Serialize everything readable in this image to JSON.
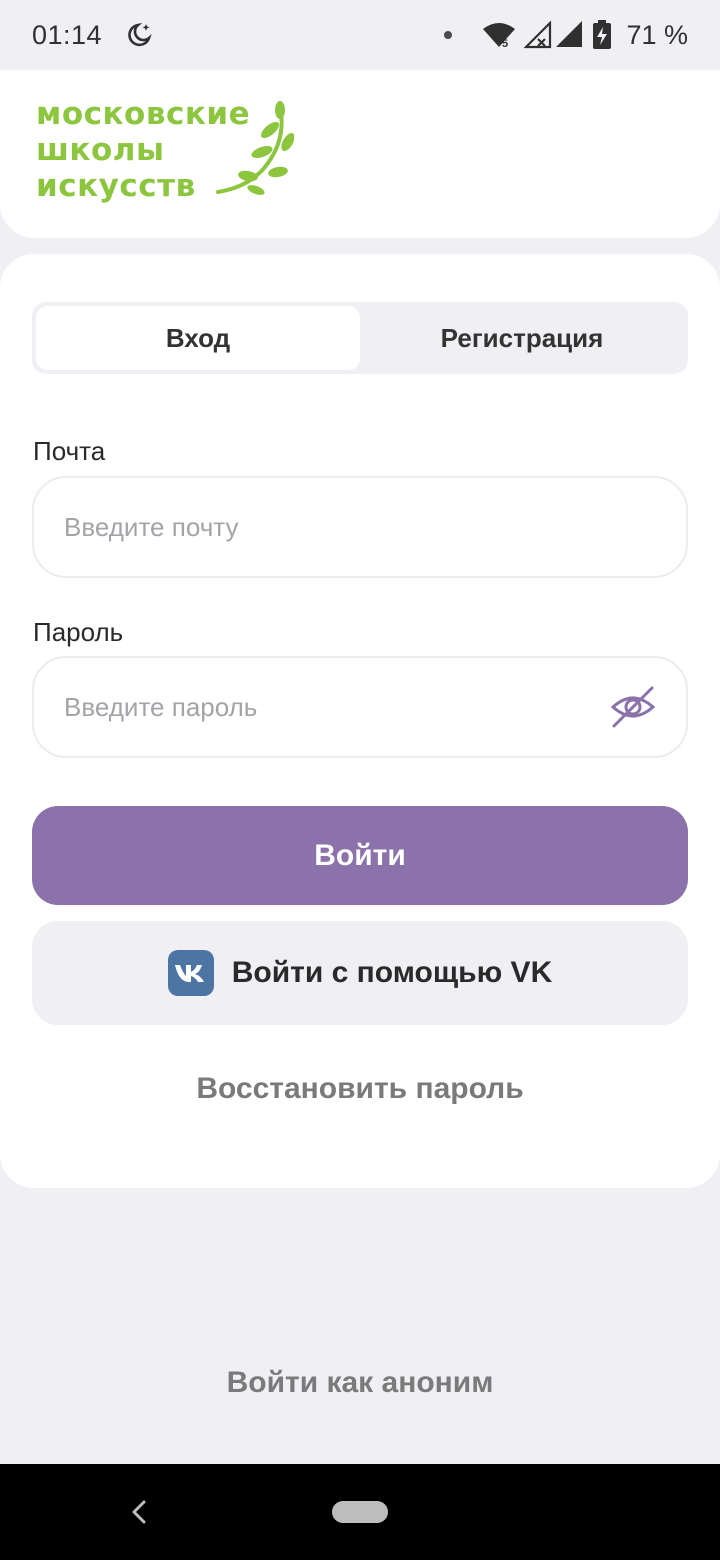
{
  "status_bar": {
    "time": "01:14",
    "battery_percent": "71 %",
    "wifi_label": "5",
    "icons": [
      "night-mode-icon",
      "notification-dot-icon",
      "wifi-icon",
      "cellular-signal-icon",
      "battery-charging-icon"
    ]
  },
  "logo": {
    "line1": "московские",
    "line2": "школы",
    "line3": "искусств",
    "color": "#8cc63f"
  },
  "tabs": [
    {
      "label": "Вход",
      "active": true
    },
    {
      "label": "Регистрация",
      "active": false
    }
  ],
  "form": {
    "email_label": "Почта",
    "email_placeholder": "Введите почту",
    "email_value": "",
    "password_label": "Пароль",
    "password_placeholder": "Введите пароль",
    "password_value": "",
    "password_toggle_icon": "eye-off-icon"
  },
  "buttons": {
    "login": "Войти",
    "vk_login": "Войти с помощью VK",
    "restore_password": "Восстановить пароль",
    "anonymous_login": "Войти как аноним"
  },
  "colors": {
    "accent": "#8b72ab",
    "vk_brand": "#4c75a3",
    "background": "#f0f0f4"
  }
}
